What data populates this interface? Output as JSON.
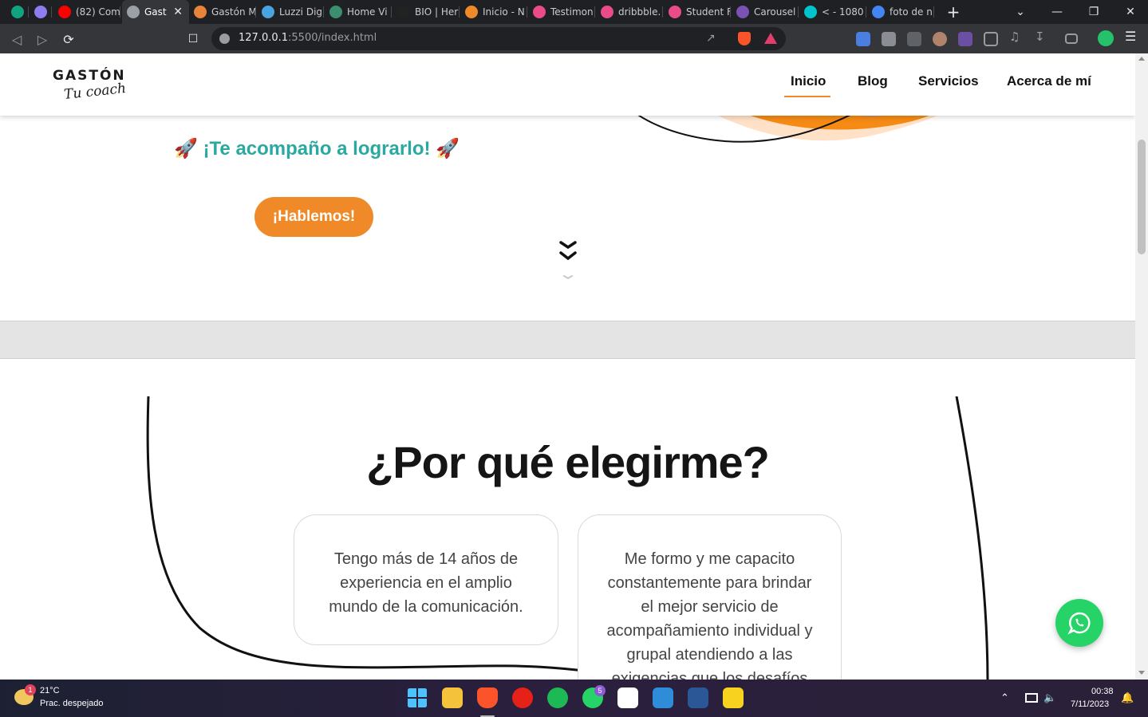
{
  "browser": {
    "tabs": [
      {
        "label": "",
        "favicon_color": "#10a37f",
        "icon": "chatgpt-icon"
      },
      {
        "label": "",
        "favicon_color": "#8e7cf0",
        "icon": "gemini-sparkle-icon"
      },
      {
        "label": "(82) Com",
        "favicon_color": "#ff0000",
        "icon": "youtube-icon"
      },
      {
        "label": "Gast",
        "favicon_color": "#9aa0a6",
        "icon": "globe-icon",
        "active": true
      },
      {
        "label": "Gastón M",
        "favicon_color": "#e8833a",
        "icon": "site-favicon"
      },
      {
        "label": "Luzzi Dig",
        "favicon_color": "#4aa3df",
        "icon": "site-favicon"
      },
      {
        "label": "Home Vi",
        "favicon_color": "#3b8f6e",
        "icon": "site-favicon"
      },
      {
        "label": "BIO | Her",
        "favicon_color": "#222222",
        "icon": "site-favicon"
      },
      {
        "label": "Inicio - N",
        "favicon_color": "#f08a28",
        "icon": "site-favicon"
      },
      {
        "label": "Testimon",
        "favicon_color": "#ea4c89",
        "icon": "dribbble-icon"
      },
      {
        "label": "dribbble.",
        "favicon_color": "#ea4c89",
        "icon": "dribbble-icon"
      },
      {
        "label": "Student F",
        "favicon_color": "#ea4c89",
        "icon": "dribbble-icon"
      },
      {
        "label": "Carousel",
        "favicon_color": "#7952b3",
        "icon": "bootstrap-icon"
      },
      {
        "label": "< - 1080",
        "favicon_color": "#00c4cc",
        "icon": "canva-icon"
      },
      {
        "label": "foto de n",
        "favicon_color": "#4285f4",
        "icon": "google-icon"
      }
    ],
    "new_tab_label": "+",
    "url_host": "127.0.0.1",
    "url_rest": ":5500/index.html"
  },
  "site": {
    "logo_main": "GASTÓN",
    "logo_sub": "Tu coach",
    "nav": [
      {
        "label": "Inicio",
        "active": true
      },
      {
        "label": "Blog"
      },
      {
        "label": "Servicios"
      },
      {
        "label": "Acerca de mí"
      }
    ],
    "hero_tagline": "¡Te acompaño a lograrlo!",
    "hero_rocket": "🚀",
    "hero_button": "¡Hablemos!",
    "why_title": "¿Por qué elegirme?",
    "cards": [
      "Tengo más de 14 años de experiencia en el amplio mundo de la comunicación.",
      "Me formo y me capacito constantemente para brindar el mejor servicio de acompañamiento individual y grupal atendiendo a las exigencias que los desafíos del"
    ],
    "accent_color": "#f08a28",
    "teal_color": "#2aa9a1",
    "whatsapp_color": "#25d366"
  },
  "taskbar": {
    "weather_temp": "21°C",
    "weather_desc": "Prac. despejado",
    "weather_badge": "1",
    "whatsapp_badge": "5",
    "time": "00:38",
    "date": "7/11/2023"
  }
}
